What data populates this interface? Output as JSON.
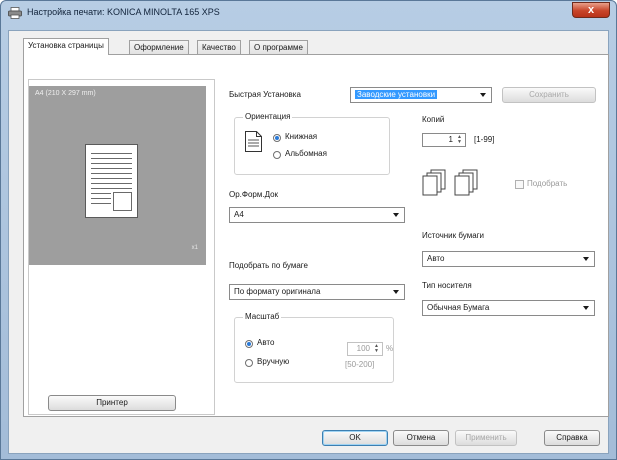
{
  "window": {
    "title": "Настройка печати: KONICA MINOLTA 165 XPS",
    "close_glyph": "x"
  },
  "tabs": [
    {
      "label": "Установка страницы",
      "active": true
    },
    {
      "label": "Оформление",
      "active": false
    },
    {
      "label": "Качество",
      "active": false
    },
    {
      "label": "О программе",
      "active": false
    }
  ],
  "preview": {
    "paper_label": "A4 (210 X 297 mm)",
    "copies_marker": "x1",
    "printer_button": "Принтер"
  },
  "quick_setup": {
    "label": "Быстрая Установка",
    "value": "Заводские установки",
    "save_button": "Сохранить"
  },
  "orientation": {
    "group_title": "Ориентация",
    "portrait": "Книжная",
    "landscape": "Альбомная",
    "selected": "portrait"
  },
  "copies": {
    "label": "Копий",
    "value": "1",
    "range": "[1-99]",
    "collate_label": "Подобрать",
    "collate_checked": false
  },
  "original_size": {
    "label": "Ор.Форм.Док",
    "value": "A4"
  },
  "paper_source": {
    "label": "Источник бумаги",
    "value": "Авто"
  },
  "fit_to_paper": {
    "label": "Подобрать по бумаге",
    "value": "По формату оригинала"
  },
  "media_type": {
    "label": "Тип носителя",
    "value": "Обычная Бумага"
  },
  "scale": {
    "group_title": "Масштаб",
    "auto": "Авто",
    "manual": "Вручную",
    "selected": "auto",
    "value": "100",
    "unit": "%",
    "range": "[50-200]"
  },
  "footer": {
    "ok": "OK",
    "cancel": "Отмена",
    "apply": "Применить",
    "help": "Справка"
  },
  "colors": {
    "accent": "#3399ff",
    "close": "#c8452a",
    "preview_bg": "#9e9e9e"
  }
}
